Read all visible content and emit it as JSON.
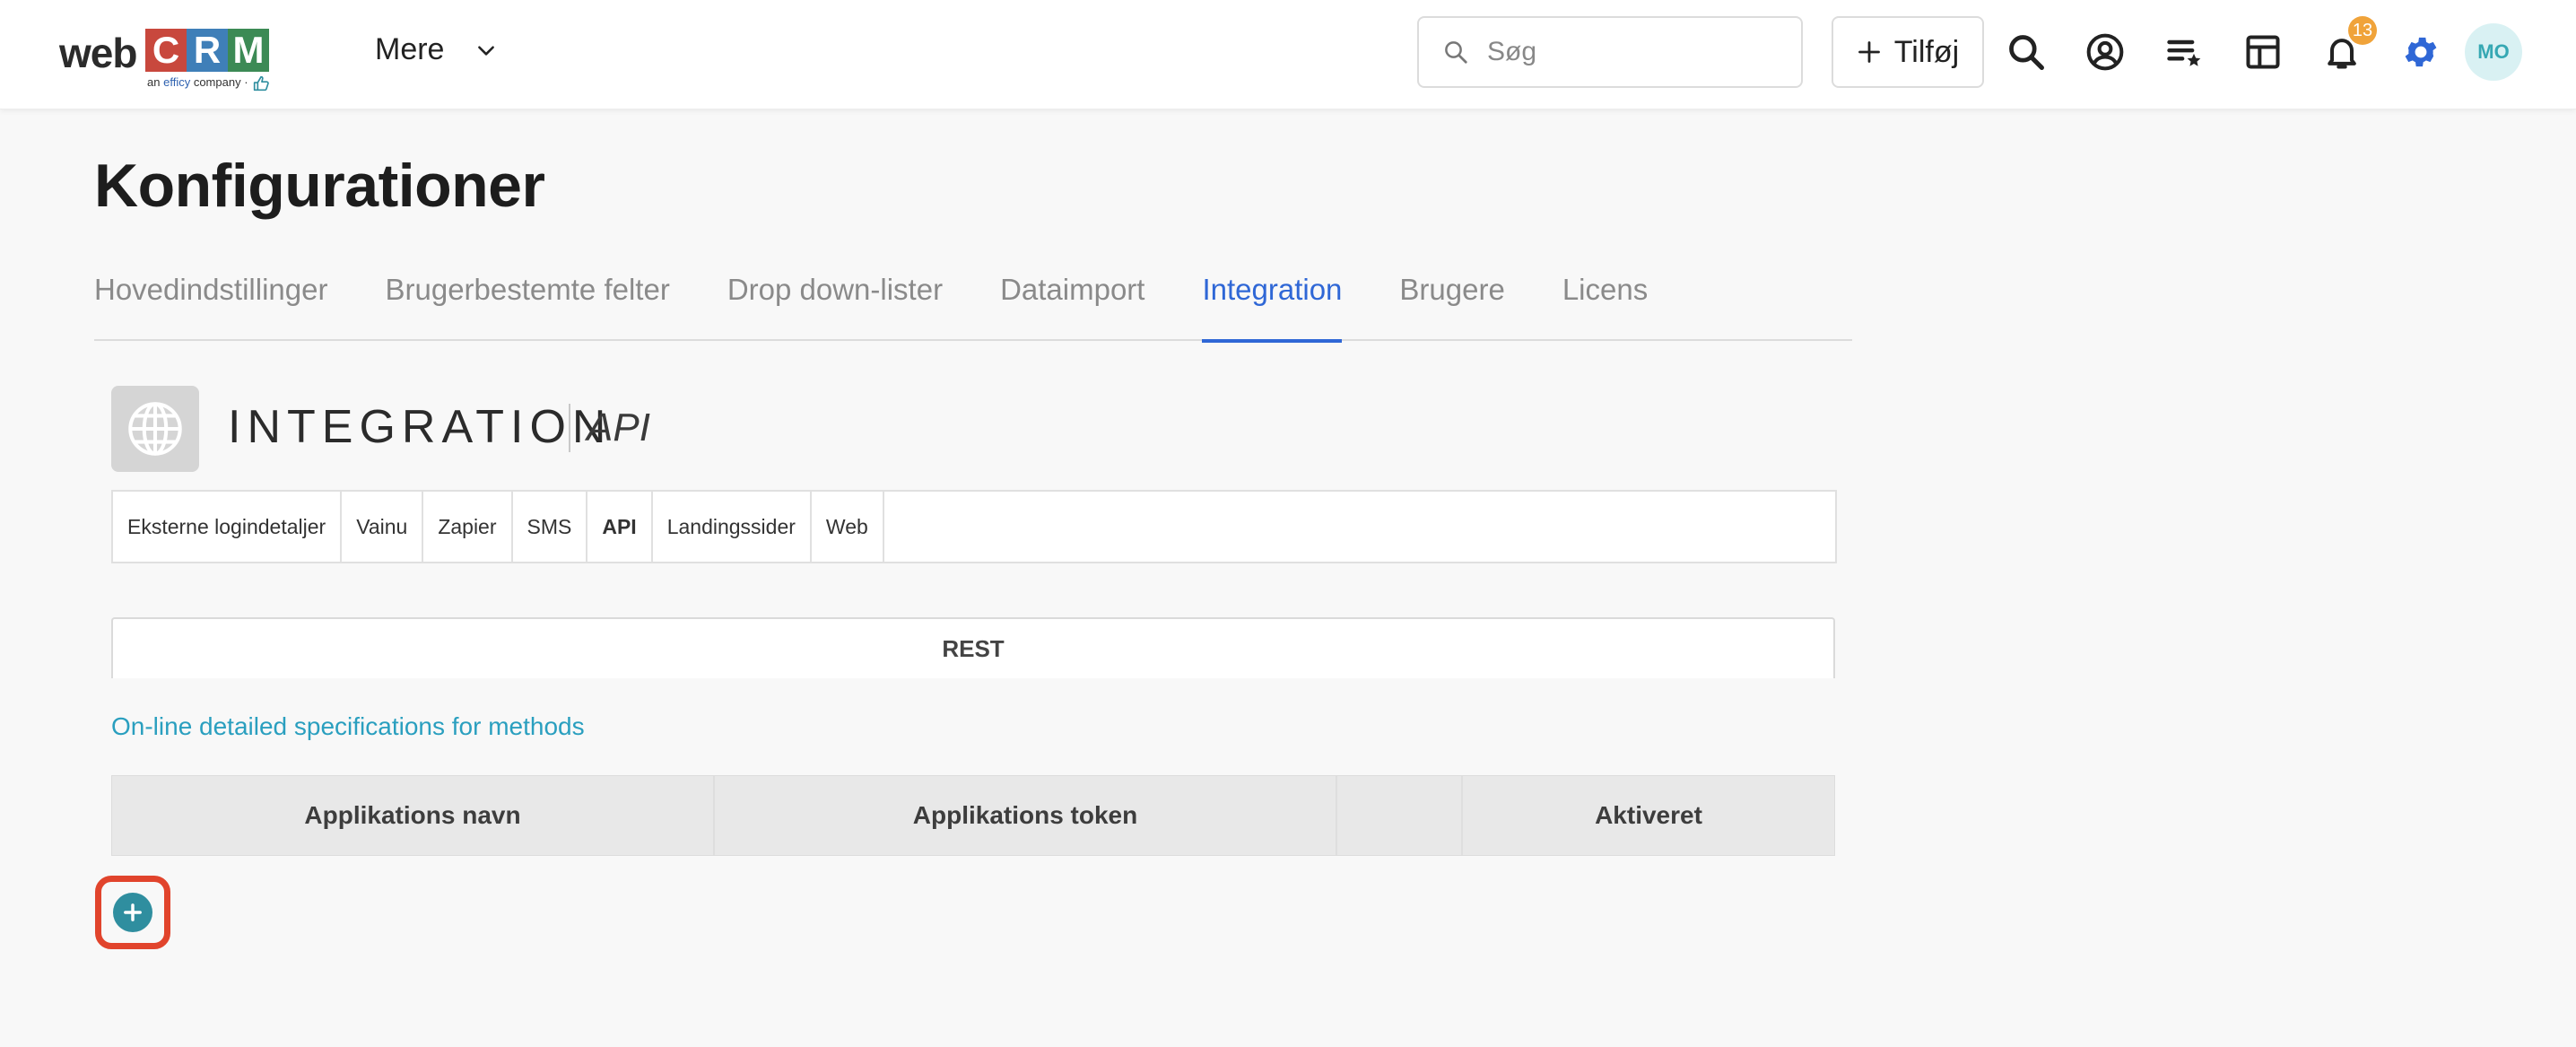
{
  "header": {
    "logo_web": "web",
    "logo_c": "C",
    "logo_r": "R",
    "logo_m": "M",
    "logo_tag_prefix": "an",
    "logo_tag_brand": "efficy",
    "logo_tag_suffix": "company ·",
    "more_label": "Mere",
    "search_placeholder": "Søg",
    "add_label": "Tilføj",
    "notification_count": "13",
    "avatar_initials": "MO"
  },
  "colors": {
    "logo_c": "#c8483d",
    "logo_r": "#3f7fb8",
    "logo_m": "#3c8a55",
    "accent": "#2f67d6",
    "link": "#2a9fbf",
    "highlight": "#e1442c"
  },
  "page": {
    "title": "Konfigurationer"
  },
  "tabs": [
    {
      "label": "Hovedindstillinger"
    },
    {
      "label": "Brugerbestemte felter"
    },
    {
      "label": "Drop down-lister"
    },
    {
      "label": "Dataimport"
    },
    {
      "label": "Integration"
    },
    {
      "label": "Brugere"
    },
    {
      "label": "Licens"
    }
  ],
  "module": {
    "title": "INTEGRATION",
    "subtitle": "API"
  },
  "subtabs": [
    {
      "label": "Eksterne logindetaljer"
    },
    {
      "label": "Vainu"
    },
    {
      "label": "Zapier"
    },
    {
      "label": "SMS"
    },
    {
      "label": "API"
    },
    {
      "label": "Landingssider"
    },
    {
      "label": "Web"
    }
  ],
  "rest": {
    "label": "REST"
  },
  "spec_link": "On-line detailed specifications for methods",
  "table": {
    "columns": [
      "Applikations navn",
      "Applikations token",
      "",
      "Aktiveret"
    ]
  }
}
